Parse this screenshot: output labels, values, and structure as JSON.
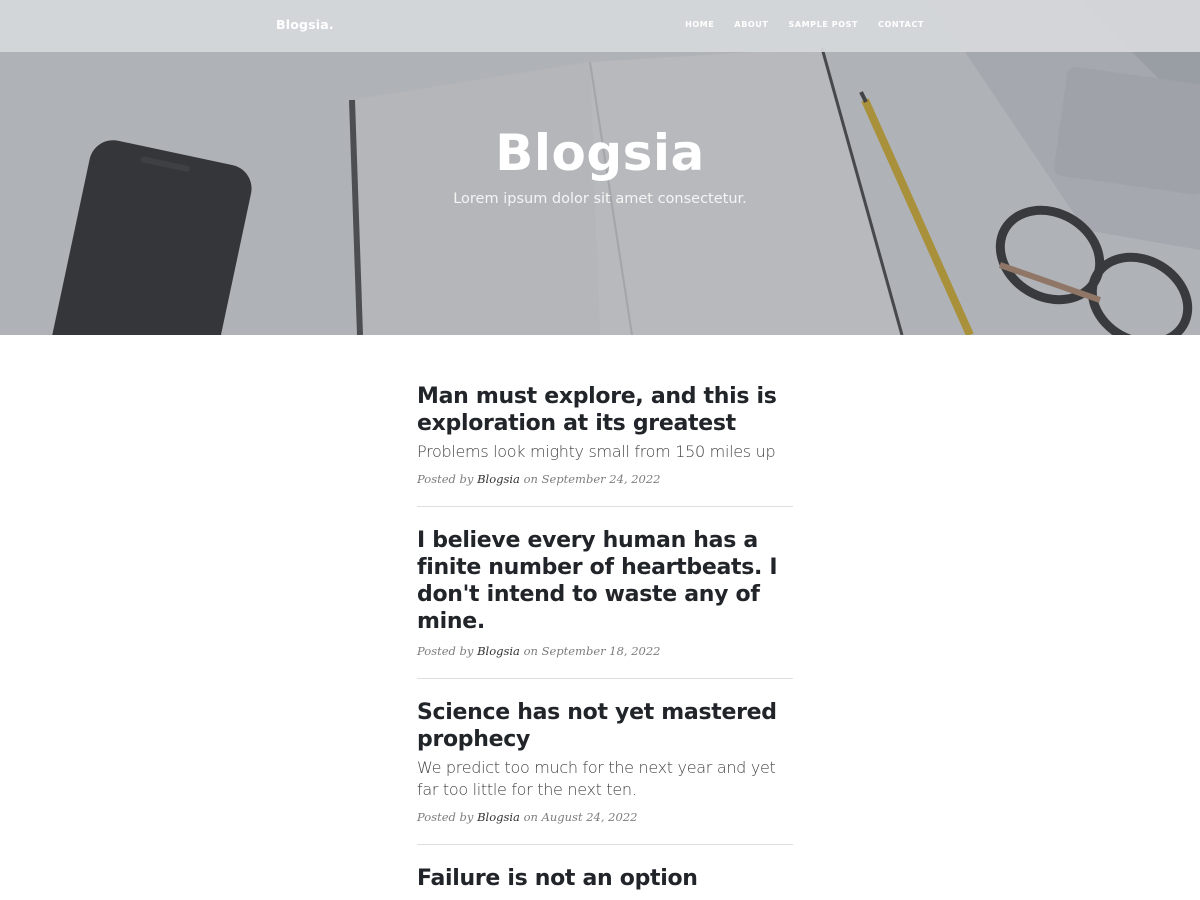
{
  "navbar": {
    "brand": "Blogsia.",
    "links": [
      {
        "label": "HOME"
      },
      {
        "label": "ABOUT"
      },
      {
        "label": "SAMPLE POST"
      },
      {
        "label": "CONTACT"
      }
    ]
  },
  "hero": {
    "title": "Blogsia",
    "subtitle": "Lorem ipsum dolor sit amet consectetur."
  },
  "posts": [
    {
      "title": "Man must explore, and this is exploration at its greatest",
      "subtitle": "Problems look mighty small from 150 miles up",
      "meta_prefix": "Posted by",
      "author": "Blogsia",
      "meta_on": "on",
      "date": "September 24, 2022"
    },
    {
      "title": "I believe every human has a finite number of heartbeats. I don't intend to waste any of mine.",
      "subtitle": "",
      "meta_prefix": "Posted by",
      "author": "Blogsia",
      "meta_on": "on",
      "date": "September 18, 2022"
    },
    {
      "title": "Science has not yet mastered prophecy",
      "subtitle": "We predict too much for the next year and yet far too little for the next ten.",
      "meta_prefix": "Posted by",
      "author": "Blogsia",
      "meta_on": "on",
      "date": "August 24, 2022"
    },
    {
      "title": "Failure is not an option",
      "subtitle": "",
      "meta_prefix": "",
      "author": "",
      "meta_on": "",
      "date": ""
    }
  ]
}
